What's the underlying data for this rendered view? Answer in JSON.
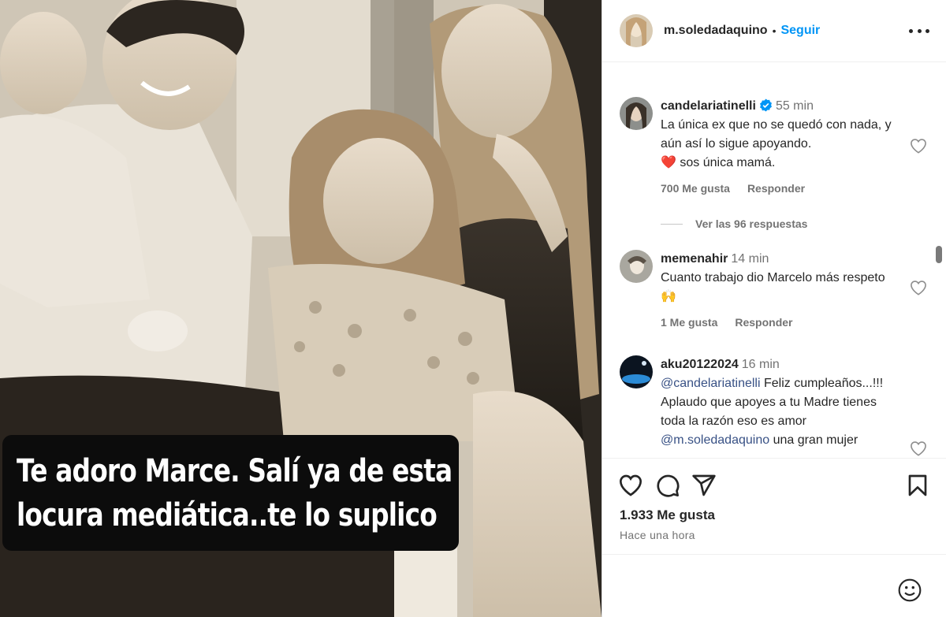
{
  "photo": {
    "caption_line1": "Te adoro Marce. Salí ya de  esta",
    "caption_line2": "locura mediática..te lo suplico"
  },
  "post": {
    "username": "m.soledadaquino",
    "separator": "•",
    "follow_label": "Seguir",
    "more_icon": "more-horizontal-icon"
  },
  "comments": [
    {
      "username": "candelariatinelli",
      "verified": true,
      "time": "55 min",
      "text": "La única ex que no se quedó con nada, y aún así lo sigue apoyando.",
      "text_emoji": "❤️",
      "text_tail": "sos única mamá.",
      "likes": "700 Me gusta",
      "reply_label": "Responder",
      "view_replies": "Ver las 96 respuestas"
    },
    {
      "username": "memenahir",
      "time": "14 min",
      "text": "Cuanto trabajo dio Marcelo más respeto",
      "text_emoji": "🙌",
      "likes": "1 Me gusta",
      "reply_label": "Responder"
    },
    {
      "username": "aku20122024",
      "time": "16 min",
      "mention1": "@candelariatinelli",
      "text": "Feliz cumpleaños...!!! Aplaudo que apoyes a tu Madre tienes toda la razón eso es amor",
      "mention2": "@m.soledadaquino",
      "text_tail": "una gran mujer"
    }
  ],
  "actions": {
    "like_icon": "heart-icon",
    "comment_icon": "comment-icon",
    "share_icon": "share-icon",
    "save_icon": "bookmark-icon",
    "likes_count": "1.933 Me gusta",
    "posted_time": "Hace una hora",
    "emoji_icon": "emoji-icon"
  },
  "colors": {
    "accent": "#0095f6",
    "verified": "#0095f6",
    "heart_emoji": "#e0245e",
    "text": "#262626",
    "muted": "#737373"
  }
}
